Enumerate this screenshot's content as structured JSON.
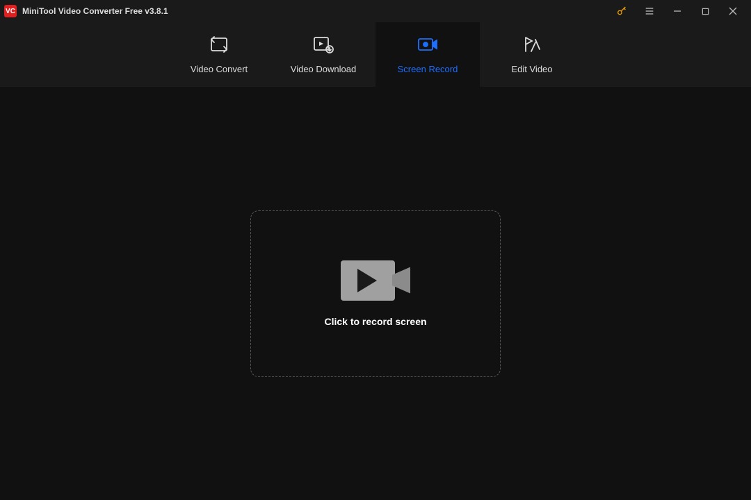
{
  "app": {
    "title": "MiniTool Video Converter Free v3.8.1"
  },
  "tabs": {
    "convert": "Video Convert",
    "download": "Video Download",
    "record": "Screen Record",
    "edit": "Edit Video"
  },
  "main": {
    "drop_label": "Click to record screen"
  }
}
